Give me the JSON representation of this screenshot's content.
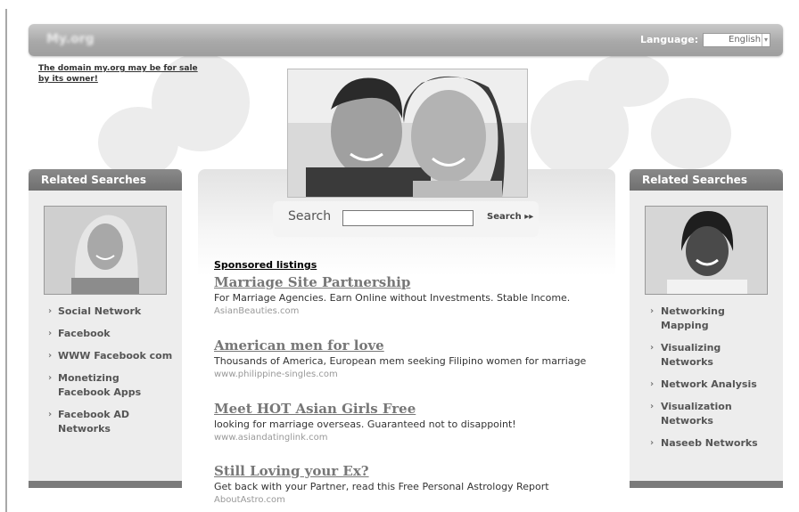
{
  "header": {
    "site_name": "My.org",
    "language_label": "Language:",
    "language_value": "English"
  },
  "domain_notice": "The domain my.org may be for sale by its owner!",
  "sidebar_left": {
    "title": "Related Searches",
    "items": [
      {
        "label": "Social Network"
      },
      {
        "label": "Facebook"
      },
      {
        "label": "WWW Facebook com"
      },
      {
        "label": "Monetizing Facebook Apps"
      },
      {
        "label": "Facebook AD Networks"
      }
    ]
  },
  "sidebar_right": {
    "title": "Related Searches",
    "items": [
      {
        "label": "Networking Mapping"
      },
      {
        "label": "Visualizing Networks"
      },
      {
        "label": "Network Analysis"
      },
      {
        "label": "Visualization Networks"
      },
      {
        "label": "Naseeb Networks"
      }
    ]
  },
  "search": {
    "label": "Search",
    "button": "Search ▸▸",
    "value": ""
  },
  "sponsored": {
    "heading": "Sponsored listings",
    "listings": [
      {
        "title": "Marriage Site Partnership",
        "description": "For Marriage Agencies. Earn Online without Investments. Stable Income.",
        "url": "AsianBeauties.com"
      },
      {
        "title": "American men for love",
        "description": "Thousands of America, European mem seeking Filipino women for marriage",
        "url": "www.philippine-singles.com"
      },
      {
        "title": "Meet HOT Asian Girls Free",
        "description": "looking for marriage overseas. Guaranteed not to disappoint!",
        "url": "www.asiandatinglink.com"
      },
      {
        "title": "Still Loving your Ex?",
        "description": "Get back with your Partner, read this Free Personal Astrology Report",
        "url": "AboutAstro.com"
      }
    ]
  }
}
